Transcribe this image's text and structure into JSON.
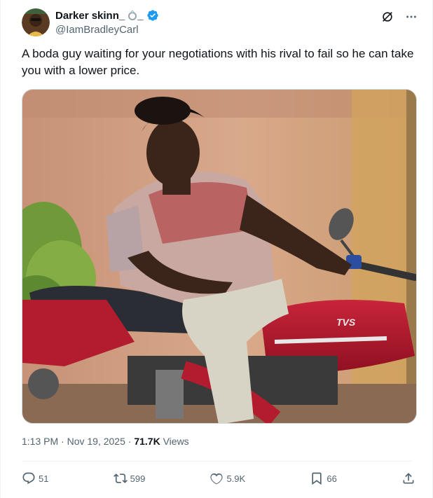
{
  "author": {
    "display_name": "Darker skinn_",
    "emoji_suffix": "_",
    "handle": "@IamBradleyCarl"
  },
  "tweet": {
    "text": "A boda guy waiting for your negotiations with his rival to fail so he can take you with a lower price.",
    "time": "1:13 PM",
    "separator": "·",
    "date": "Nov 19, 2025",
    "separator2": "·",
    "views_count": "71.7K",
    "views_label": "Views"
  },
  "media": {
    "bike_brand": "TVS"
  },
  "actions": {
    "replies": "51",
    "reposts": "599",
    "likes": "5.9K",
    "bookmarks": "66"
  },
  "colors": {
    "verified": "#1d9bf0",
    "text_secondary": "#536471",
    "text_primary": "#0f1419"
  }
}
